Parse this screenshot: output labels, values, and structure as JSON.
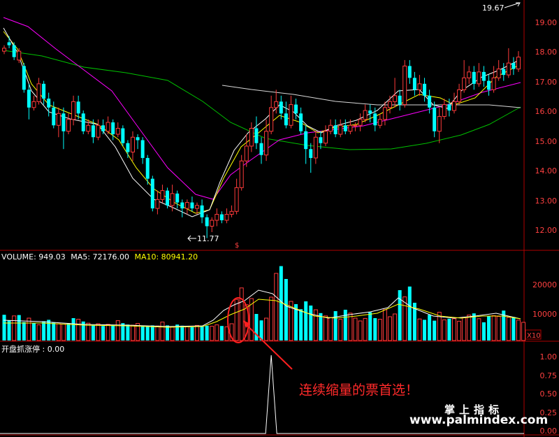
{
  "chart_data": [
    {
      "type": "candlestick",
      "title": "",
      "y_ticks": [
        "19.00",
        "18.00",
        "17.00",
        "16.00",
        "15.00",
        "14.00",
        "13.00",
        "12.00"
      ],
      "ylim": [
        11.4,
        19.8
      ],
      "annotations": {
        "high": "19.67",
        "low": "11.77"
      },
      "candles": [
        [
          18.1,
          18.2,
          18.3,
          18.0
        ],
        [
          18.4,
          18.3,
          18.6,
          18.2
        ],
        [
          18.3,
          17.9,
          18.4,
          17.8
        ],
        [
          17.8,
          18.1,
          18.2,
          17.7
        ],
        [
          17.6,
          16.8,
          17.7,
          16.7
        ],
        [
          16.8,
          16.2,
          17.0,
          15.8
        ],
        [
          16.2,
          16.4,
          16.6,
          16.1
        ],
        [
          16.4,
          17.0,
          17.2,
          16.3
        ],
        [
          17.0,
          16.5,
          17.1,
          16.3
        ],
        [
          16.5,
          16.2,
          16.7,
          15.9
        ],
        [
          16.2,
          15.6,
          16.4,
          15.5
        ],
        [
          15.6,
          16.0,
          16.2,
          15.2
        ],
        [
          16.0,
          15.4,
          16.2,
          14.8
        ],
        [
          15.4,
          15.8,
          16.0,
          15.3
        ],
        [
          15.8,
          16.4,
          16.6,
          15.6
        ],
        [
          16.4,
          16.0,
          16.6,
          15.8
        ],
        [
          16.0,
          15.4,
          16.1,
          15.3
        ],
        [
          15.4,
          15.6,
          15.8,
          15.3
        ],
        [
          15.6,
          15.2,
          15.8,
          15.0
        ],
        [
          15.2,
          15.6,
          15.8,
          15.1
        ],
        [
          15.6,
          15.4,
          15.8,
          15.3
        ],
        [
          15.4,
          15.7,
          15.9,
          15.3
        ],
        [
          15.7,
          15.3,
          15.8,
          15.1
        ],
        [
          15.3,
          15.5,
          15.7,
          15.2
        ],
        [
          15.5,
          15.0,
          15.6,
          14.9
        ],
        [
          15.0,
          14.7,
          15.1,
          14.5
        ],
        [
          14.7,
          15.2,
          15.4,
          14.4
        ],
        [
          15.2,
          15.1,
          15.3,
          14.8
        ],
        [
          15.1,
          14.5,
          15.2,
          14.3
        ],
        [
          14.5,
          13.8,
          14.6,
          13.6
        ],
        [
          13.8,
          12.8,
          13.9,
          12.7
        ],
        [
          12.8,
          13.1,
          13.4,
          12.6
        ],
        [
          13.1,
          13.4,
          13.6,
          13.0
        ],
        [
          13.4,
          12.9,
          13.5,
          12.8
        ],
        [
          12.9,
          13.3,
          13.6,
          12.7
        ],
        [
          13.3,
          13.0,
          13.4,
          12.8
        ],
        [
          13.0,
          12.8,
          13.1,
          12.5
        ],
        [
          12.8,
          13.0,
          13.1,
          12.6
        ],
        [
          13.0,
          12.8,
          13.2,
          12.7
        ],
        [
          12.8,
          12.9,
          13.0,
          12.6
        ],
        [
          12.9,
          12.5,
          13.1,
          12.3
        ],
        [
          12.5,
          12.2,
          12.6,
          11.8
        ],
        [
          12.2,
          12.4,
          12.5,
          12.0
        ],
        [
          12.4,
          12.6,
          12.8,
          12.2
        ],
        [
          12.6,
          12.4,
          12.7,
          12.3
        ],
        [
          12.4,
          12.6,
          12.8,
          12.3
        ],
        [
          12.6,
          12.7,
          12.9,
          12.5
        ],
        [
          12.7,
          13.5,
          13.8,
          12.6
        ],
        [
          13.5,
          14.4,
          14.6,
          13.4
        ],
        [
          14.4,
          14.9,
          15.3,
          14.2
        ],
        [
          14.9,
          15.5,
          15.7,
          14.7
        ],
        [
          15.5,
          15.0,
          15.9,
          14.8
        ],
        [
          15.0,
          14.6,
          15.2,
          14.3
        ],
        [
          14.6,
          15.4,
          15.8,
          14.4
        ],
        [
          15.4,
          16.2,
          16.6,
          15.3
        ],
        [
          16.2,
          16.4,
          16.8,
          16.0
        ],
        [
          16.4,
          16.0,
          16.6,
          15.8
        ],
        [
          16.0,
          15.6,
          16.4,
          15.5
        ],
        [
          15.6,
          16.3,
          16.6,
          15.5
        ],
        [
          16.3,
          16.0,
          16.5,
          15.8
        ],
        [
          16.0,
          15.4,
          16.2,
          15.3
        ],
        [
          15.4,
          14.8,
          15.6,
          14.3
        ],
        [
          14.8,
          14.5,
          15.0,
          14.0
        ],
        [
          14.5,
          15.2,
          15.4,
          14.3
        ],
        [
          15.2,
          15.0,
          15.4,
          14.8
        ],
        [
          15.0,
          15.4,
          15.6,
          14.9
        ],
        [
          15.4,
          15.6,
          15.8,
          15.3
        ],
        [
          15.6,
          15.3,
          15.8,
          15.2
        ],
        [
          15.3,
          15.6,
          15.8,
          15.2
        ],
        [
          15.6,
          15.4,
          15.8,
          15.3
        ],
        [
          15.4,
          15.6,
          15.8,
          15.3
        ],
        [
          15.6,
          15.6,
          15.7,
          15.4
        ],
        [
          15.6,
          15.8,
          16.0,
          15.4
        ],
        [
          15.8,
          16.1,
          16.3,
          15.7
        ],
        [
          16.1,
          16.0,
          16.3,
          15.7
        ],
        [
          16.0,
          15.6,
          16.2,
          15.4
        ],
        [
          15.6,
          15.8,
          16.0,
          15.5
        ],
        [
          15.8,
          16.2,
          16.4,
          15.6
        ],
        [
          16.2,
          16.4,
          16.6,
          16.0
        ],
        [
          16.4,
          16.6,
          17.2,
          16.2
        ],
        [
          16.6,
          16.3,
          16.8,
          16.1
        ],
        [
          16.3,
          17.6,
          17.8,
          16.2
        ],
        [
          17.6,
          17.2,
          17.8,
          17.0
        ],
        [
          17.2,
          16.8,
          17.4,
          16.6
        ],
        [
          16.8,
          17.0,
          17.3,
          16.6
        ],
        [
          17.0,
          16.6,
          17.2,
          16.4
        ],
        [
          16.6,
          16.2,
          16.8,
          16.0
        ],
        [
          16.2,
          15.4,
          16.4,
          15.2
        ],
        [
          15.4,
          15.9,
          16.2,
          15.0
        ],
        [
          15.9,
          16.3,
          16.5,
          15.8
        ],
        [
          16.3,
          16.1,
          16.5,
          15.9
        ],
        [
          16.1,
          16.4,
          16.7,
          16.0
        ],
        [
          16.4,
          16.8,
          17.0,
          16.3
        ],
        [
          16.8,
          17.2,
          17.8,
          16.7
        ],
        [
          17.2,
          17.4,
          17.6,
          17.0
        ],
        [
          17.4,
          17.0,
          17.6,
          16.8
        ],
        [
          17.0,
          17.4,
          17.7,
          16.9
        ],
        [
          17.4,
          17.1,
          17.6,
          16.9
        ],
        [
          17.1,
          16.8,
          17.3,
          16.6
        ],
        [
          16.8,
          17.2,
          17.6,
          16.7
        ],
        [
          17.2,
          17.5,
          17.8,
          17.1
        ],
        [
          17.5,
          17.3,
          17.7,
          17.1
        ],
        [
          17.3,
          17.7,
          18.2,
          17.2
        ],
        [
          17.7,
          17.5,
          17.9,
          17.3
        ],
        [
          17.5,
          17.9,
          18.1,
          17.4
        ]
      ]
    },
    {
      "type": "bar",
      "title": "",
      "y_ticks": [
        "20000",
        "10000"
      ],
      "ylim": [
        0,
        28000
      ],
      "volumes": [
        9200,
        7200,
        8800,
        9100,
        6600,
        8000,
        6200,
        5600,
        6900,
        7400,
        6500,
        6000,
        5900,
        6200,
        8000,
        7600,
        6800,
        6200,
        5500,
        6000,
        5200,
        5800,
        5600,
        7100,
        6200,
        5700,
        5500,
        6100,
        5300,
        5100,
        5400,
        5200,
        6600,
        5400,
        4800,
        5700,
        5300,
        5000,
        4800,
        5400,
        5200,
        5300,
        5100,
        5600,
        5200,
        4900,
        6000,
        14700,
        18800,
        12800,
        15000,
        9500,
        7200,
        8000,
        15500,
        24000,
        26600,
        22000,
        14000,
        13000,
        11200,
        14000,
        12500,
        11000,
        9800,
        8800,
        8200,
        10500,
        7600,
        11000,
        9800,
        8000,
        7000,
        7900,
        10100,
        8000,
        7600,
        11000,
        8500,
        9500,
        18000,
        15600,
        19300,
        13500,
        7700,
        7400,
        9200,
        7100,
        10100,
        7400,
        7800,
        7800,
        6900,
        8300,
        9100,
        9700,
        7800,
        6500,
        8700,
        8900,
        8600,
        10700,
        8300,
        8400,
        7300,
        6500
      ],
      "vol_up": [
        false,
        false,
        true,
        false,
        false,
        true,
        false,
        true,
        false,
        false,
        false,
        true,
        true,
        false,
        false,
        true,
        false,
        true,
        false,
        true,
        false,
        true,
        false,
        true,
        false,
        false,
        true,
        true,
        false,
        false,
        false,
        true,
        true,
        false,
        true,
        false,
        false,
        true,
        false,
        true,
        false,
        false,
        true,
        true,
        false,
        true,
        true,
        true,
        true,
        true,
        true,
        false,
        false,
        true,
        true,
        true,
        false,
        false,
        true,
        false,
        false,
        false,
        false,
        true,
        false,
        true,
        true,
        false,
        true,
        false,
        true,
        true,
        true,
        true,
        false,
        false,
        true,
        true,
        true,
        true,
        false,
        true,
        false,
        false,
        true,
        false,
        false,
        false,
        true,
        true,
        false,
        true,
        true,
        true,
        true,
        false,
        true,
        false,
        false,
        true,
        true,
        false,
        true,
        false,
        true,
        true
      ]
    },
    {
      "type": "line",
      "title": "",
      "y_ticks": [
        "1.00",
        "0.75",
        "0.50",
        "0.25",
        "0.00"
      ],
      "ylim": [
        0,
        1.05
      ],
      "signal_index": 54
    }
  ],
  "price_panel": {
    "tick_19": "19.00",
    "tick_18": "18.00",
    "tick_17": "17.00",
    "tick_16": "16.00",
    "tick_15": "15.00",
    "tick_14": "14.00",
    "tick_13": "13.00",
    "tick_12": "12.00"
  },
  "volume_panel": {
    "label": "VOLUME: 949.03",
    "ma5": "MA5: 72176.00",
    "ma10": "MA10: 80941.20",
    "tick_20000": "20000",
    "tick_10000": "10000",
    "unit": "X10"
  },
  "indicator_panel": {
    "label": "开盘抓涨停 : 0.00",
    "tick_100": "1.00",
    "tick_075": "0.75",
    "tick_050": "0.50",
    "tick_025": "0.25",
    "tick_000": "0.00"
  },
  "annotation_text": "连续缩量的票首选！",
  "watermark_cn": "掌上指标",
  "watermark_url": "www.palmindex.com",
  "marker_glyph": "$",
  "colors": {
    "up": "#ff3b3b",
    "down": "#00ffff",
    "ma_fast": "#ffffff",
    "ma_mid": "#ffff00",
    "ma_slow": "#ff00ff",
    "ma_long": "#00c000",
    "grid": "#9b0000",
    "annotation": "#ff2a2a"
  }
}
